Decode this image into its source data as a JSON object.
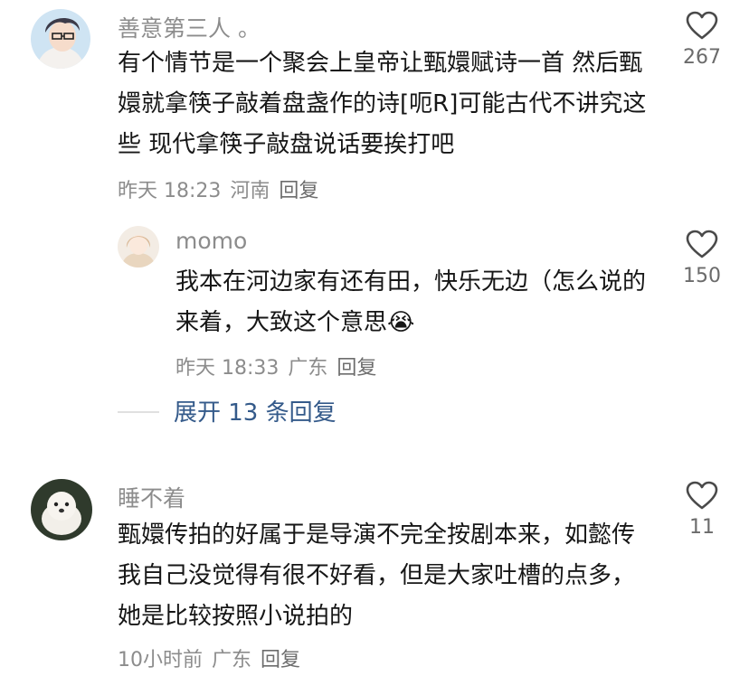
{
  "comments": [
    {
      "username": "善意第三人 。",
      "text": "有个情节是一个聚会上皇帝让甄嬛赋诗一首 然后甄嬛就拿筷子敲着盘盏作的诗[呃R]可能古代不讲究这些 现代拿筷子敲盘说话要挨打吧",
      "time": "昨天 18:23",
      "location": "河南",
      "reply_label": "回复",
      "likes": "267",
      "replies": [
        {
          "username": "momo",
          "text": "我本在河边家有还有田，快乐无边（怎么说的来着，大致这个意思",
          "emoji": "😭",
          "time": "昨天 18:33",
          "location": "广东",
          "reply_label": "回复",
          "likes": "150"
        }
      ],
      "expand_label": "展开 13 条回复"
    },
    {
      "username": "睡不着",
      "text": "甄嬛传拍的好属于是导演不完全按剧本来，如懿传我自己没觉得有很不好看，但是大家吐槽的点多，她是比较按照小说拍的",
      "time": "10小时前",
      "location": "广东",
      "reply_label": "回复",
      "likes": "11"
    }
  ],
  "icons": {
    "like": "heart-outline-icon"
  },
  "colors": {
    "text": "#161616",
    "meta": "#8c8c8c",
    "link": "#345a8a",
    "background": "#ffffff"
  }
}
